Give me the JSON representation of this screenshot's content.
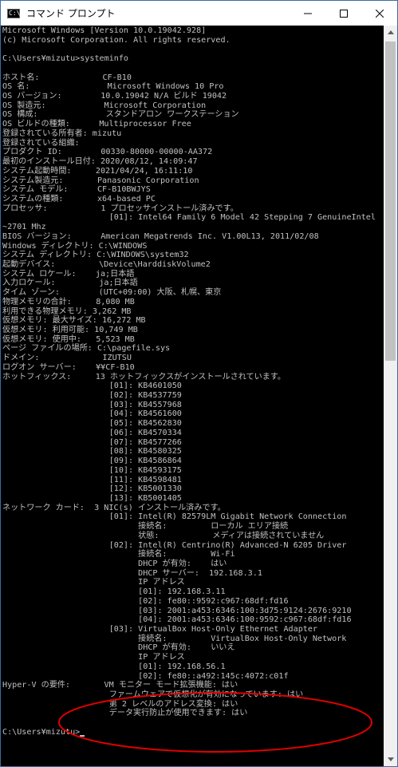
{
  "window": {
    "title": "コマンド プロンプト",
    "icon_label": "C:\\",
    "controls": [
      "minimize-icon",
      "maximize-icon",
      "close-icon"
    ]
  },
  "console": {
    "lines": [
      "Microsoft Windows [Version 10.0.19042.928]",
      "(c) Microsoft Corporation. All rights reserved.",
      "",
      "C:\\Users¥mizutu>systeminfo",
      "",
      "ホスト名:             CF-B10",
      "OS 名:                Microsoft Windows 10 Pro",
      "OS バージョン:        10.0.19042 N/A ビルド 19042",
      "OS 製造元:            Microsoft Corporation",
      "OS 構成:              スタンドアロン ワークステーション",
      "OS ビルドの種類:      Multiprocessor Free",
      "登録されている所有者: mizutu",
      "登録されている組織:",
      "プロダクト ID:        00330-80000-00000-AA372",
      "最初のインストール日付: 2020/08/12, 14:09:47",
      "システム起動時間:     2021/04/24, 16:11:10",
      "システム製造元:       Panasonic Corporation",
      "システム モデル:      CF-B10BWJYS",
      "システムの種類:       x64-based PC",
      "プロセッサ:           1 プロセッサインストール済みです。",
      "                      [01]: Intel64 Family 6 Model 42 Stepping 7 GenuineIntel",
      "~2701 Mhz",
      "BIOS バージョン:      American Megatrends Inc. V1.00L13, 2011/02/08",
      "Windows ディレクトリ: C:\\WINDOWS",
      "システム ディレクトリ: C:\\WINDOWS\\system32",
      "起動デバイス:         \\Device\\HarddiskVolume2",
      "システム ロケール:    ja;日本語",
      "入力ロケール:         ja;日本語",
      "タイム ゾーン:        (UTC+09:00) 大阪、札幌、東京",
      "物理メモリの合計:     8,080 MB",
      "利用できる物理メモリ: 3,262 MB",
      "仮想メモリ: 最大サイズ: 16,272 MB",
      "仮想メモリ: 利用可能: 10,749 MB",
      "仮想メモリ: 使用中:   5,523 MB",
      "ページ ファイルの場所: C:\\pagefile.sys",
      "ドメイン:             IZUTSU",
      "ログオン サーバー:    ¥¥CF-B10",
      "ホットフィックス:     13 ホットフィックスがインストールされています。",
      "                      [01]: KB4601050",
      "                      [02]: KB4537759",
      "                      [03]: KB4557968",
      "                      [04]: KB4561600",
      "                      [05]: KB4562830",
      "                      [06]: KB4570334",
      "                      [07]: KB4577266",
      "                      [08]: KB4580325",
      "                      [09]: KB4586864",
      "                      [10]: KB4593175",
      "                      [11]: KB4598481",
      "                      [12]: KB5001330",
      "                      [13]: KB5001405",
      "ネットワーク カード:  3 NIC(s) インストール済みです。",
      "                      [01]: Intel(R) 82579LM Gigabit Network Connection",
      "                            接続名:         ローカル エリア接続",
      "                            状態:           メディアは接続されていません",
      "                      [02]: Intel(R) Centrino(R) Advanced-N 6205 Driver",
      "                            接続名:         Wi-Fi",
      "                            DHCP が有効:    はい",
      "                            DHCP サーバー:  192.168.3.1",
      "                            IP アドレス",
      "                            [01]: 192.168.3.11",
      "                            [02]: fe80::9592:c967:68df:fd16",
      "                            [03]: 2001:a453:6346:100:3d75:9124:2676:9210",
      "                            [04]: 2001:a453:6346:100:9592:c967:68df:fd16",
      "                      [03]: VirtualBox Host-Only Ethernet Adapter",
      "                            接続名:         VirtualBox Host-Only Network",
      "                            DHCP が有効:    いいえ",
      "                            IP アドレス",
      "                            [01]: 192.168.56.1",
      "                            [02]: fe80::a492:145c:4072:c01f",
      "Hyper-V の要件:       VM モニター モード拡張機能: はい",
      "                      ファームウェアで仮想化が有効になっています: はい",
      "                      第 2 レベルのアドレス変換: はい",
      "                      データ実行防止が使用できます: はい",
      "",
      "C:\\Users¥mizutu>"
    ]
  },
  "annotation": {
    "shape": "ellipse",
    "color": "#e00000"
  }
}
